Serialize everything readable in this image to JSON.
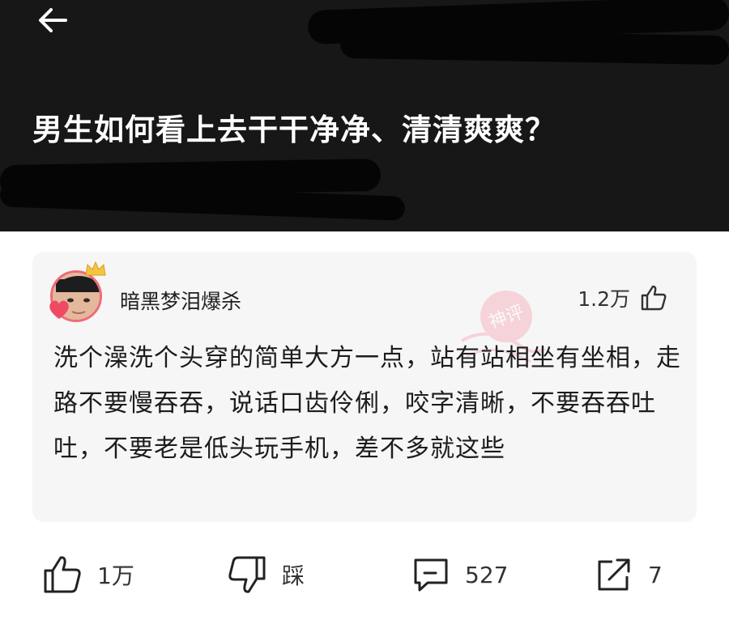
{
  "header": {
    "title": "男生如何看上去干干净净、清清爽爽？",
    "back_icon": "arrow-left-icon",
    "background": "#171717"
  },
  "comment": {
    "username": "暗黑梦泪爆杀",
    "likes": "1.2万",
    "like_icon": "thumbs-up-icon",
    "stamp_text": "神评",
    "stamp_color": "#f4a6b5",
    "text": "洗个澡洗个头穿的简单大方一点，站有站相坐有坐相，走路不要慢吞吞，说话口齿伶俐，咬字清晰，不要吞吞吐吐，不要老是低头玩手机，差不多就这些",
    "card_background": "#f6f6f6"
  },
  "actions": {
    "like": {
      "icon": "thumbs-up-icon",
      "label": "1万"
    },
    "dislike": {
      "icon": "thumbs-down-icon",
      "label": "踩"
    },
    "comment": {
      "icon": "comment-icon",
      "label": "527"
    },
    "share": {
      "icon": "share-icon",
      "label": "7"
    }
  }
}
